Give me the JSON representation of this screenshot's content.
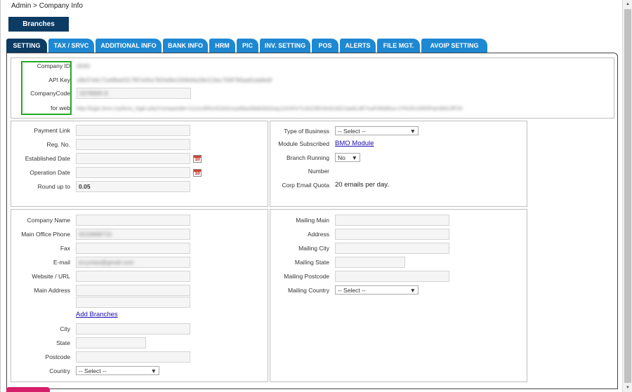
{
  "breadcrumb": "Admin > Company Info",
  "branches_button": "Branches",
  "tabs": [
    "SETTING",
    "TAX / SRVC",
    "ADDITIONAL INFO",
    "BANK INFO",
    "HRM",
    "PIC",
    "INV. SETTING",
    "POS",
    "ALERTS",
    "FILE MGT.",
    "AVOIP SETTING"
  ],
  "company": {
    "id_label": "Company ID",
    "id_value": "0043",
    "api_label": "API Key",
    "api_value": "c8b37e6c71e6fba0317f97e05e7824d9e1006d4a29e113ac759f790aa61da9e0f",
    "code_label": "CompanyCode",
    "code_value": "3378995 8",
    "web_label": "for web",
    "web_value": "http://login.bmo.my/bmo_login.php?companide=11ucs3R0c0t16d1scp6ba43bdcbi03say11K4Fe7UAiZ2BV4mKo6ZUaa6LdE7ooF4Wd0uo-t7F6Jfn1RR0Fqm66SJfF25"
  },
  "left_top": {
    "payment_link": "Payment Link",
    "reg_no": "Reg. No.",
    "established_date": "Established Date",
    "operation_date": "Operation Date",
    "round_up_to": "Round up to",
    "round_up_value": "0.05",
    "cal_icon_text": "10"
  },
  "right_top": {
    "type_of_business": "Type of Business",
    "select_placeholder": "-- Select --",
    "module_subscribed": "Module Subscribed",
    "bmo_module": "BMO Module",
    "branch_running": "Branch Running",
    "branch_running_value": "No",
    "number": "Number",
    "corp_email_quota": "Corp Email Quota",
    "quota_value": "20 emails per day."
  },
  "left_bottom": {
    "company_name": "Company Name",
    "main_office_phone": "Main Office Phone",
    "phone_value": "0019988715",
    "fax": "Fax",
    "email": "E-mail",
    "email_value": "jncyntas@gmail.com",
    "website": "Website / URL",
    "main_address": "Main Address",
    "add_branches": "Add Branches",
    "city": "City",
    "state": "State",
    "postcode": "Postcode",
    "country": "Country",
    "country_select": "-- Select --"
  },
  "right_bottom": {
    "mailing_main": "Mailing Main",
    "address": "Address",
    "mailing_city": "Mailing City",
    "mailing_state": "Mailing State",
    "mailing_postcode": "Mailing Postcode",
    "mailing_country": "Mailing Country",
    "country_select": "-- Select --"
  },
  "colors": {
    "navy": "#0c3b63",
    "tab_blue": "#1e88d2",
    "highlight_green": "#22aa22",
    "accent_pink": "#d61e6a"
  }
}
